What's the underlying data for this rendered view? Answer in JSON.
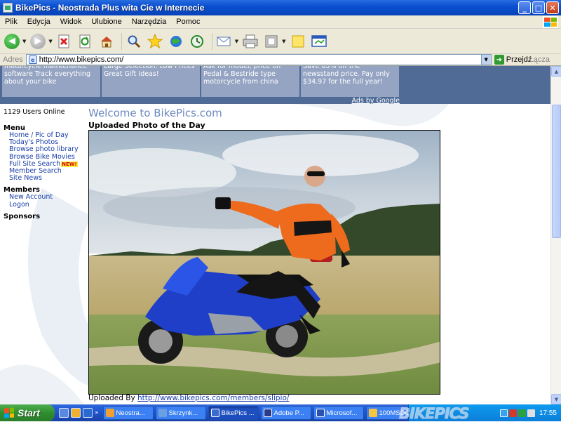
{
  "window": {
    "title": "BikePics - Neostrada Plus wita Cie w Internecie",
    "buttons": {
      "minimize": "_",
      "maximize": "□",
      "close": "✕"
    }
  },
  "menubar": {
    "items": [
      "Plik",
      "Edycja",
      "Widok",
      "Ulubione",
      "Narzędzia",
      "Pomoc"
    ]
  },
  "toolbar": {
    "icons": [
      "back-icon",
      "forward-icon",
      "stop-icon",
      "refresh-icon",
      "home-icon",
      "search-icon",
      "favorites-icon",
      "media-icon",
      "history-icon",
      "mail-icon",
      "print-icon",
      "edit-icon",
      "discuss-icon",
      "messenger-icon"
    ]
  },
  "addressbar": {
    "label": "Adres",
    "url": "http://www.bikepics.com/",
    "go_label": "Przejdź",
    "links_label": "Łącza"
  },
  "ads": {
    "boxes": [
      {
        "text": "motorcycle maintenance software Track everything about your bike"
      },
      {
        "text": "Large Selection. Low Prices Great Gift Ideas!"
      },
      {
        "text": "Ask for model, price on Pedal & Bestride type motorcycle from china"
      },
      {
        "text": "Save 65% off the newsstand price. Pay only $34.97 for the full year!"
      }
    ],
    "ads_by": "Ads by Google"
  },
  "sidebar": {
    "users_online": "1129 Users Online",
    "menu_heading": "Menu",
    "menu_items": [
      "Home / Pic of Day",
      "Today's Photos",
      "Browse photo library",
      "Browse Bike Movies",
      "Full Site Search",
      "Member Search",
      "Site News"
    ],
    "new_badge": "NEW!",
    "members_heading": "Members",
    "members_items": [
      "New Account",
      "Logon"
    ],
    "sponsors_heading": "Sponsors"
  },
  "main": {
    "welcome": "Welcome to BikePics.com",
    "section_title": "Uploaded Photo of the Day",
    "uploaded_by_label": "Uploaded By",
    "uploaded_by_link": "http://www.bikepics.com/members/slipio/"
  },
  "taskbar": {
    "start_label": "Start",
    "more": "»",
    "tasks": [
      {
        "label": "Neostra...",
        "color": "#f0a030"
      },
      {
        "label": "Skrzynk...",
        "color": "#6aa0e0"
      },
      {
        "label": "BikePics ...",
        "color": "#3a6ccf"
      },
      {
        "label": "Adobe P...",
        "color": "#2a3a8a"
      },
      {
        "label": "Microsof...",
        "color": "#2a50b0"
      },
      {
        "label": "100MSDCF",
        "color": "#f5c542"
      }
    ],
    "active_task": 2,
    "watermark": "BIKEPICS",
    "clock": "17:55"
  }
}
